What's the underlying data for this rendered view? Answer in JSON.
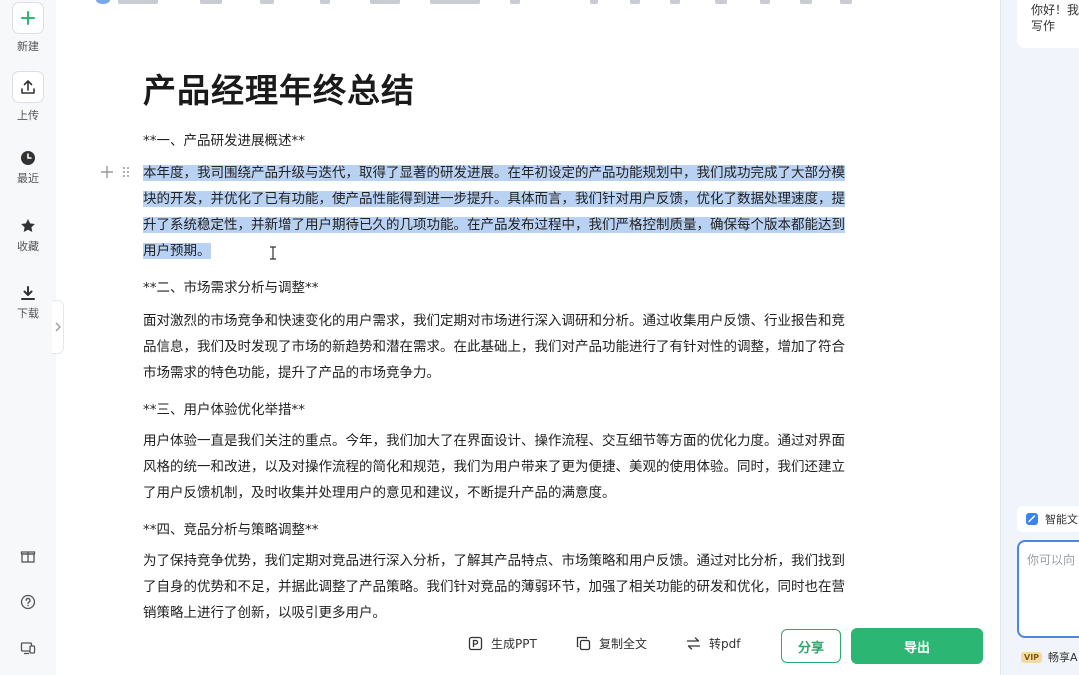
{
  "sidebar": {
    "new_label": "新建",
    "upload_label": "上传",
    "recent_label": "最近",
    "favorites_label": "收藏",
    "download_label": "下载"
  },
  "document": {
    "title": "产品经理年终总结",
    "sections": [
      {
        "heading": "**一、产品研发进展概述**",
        "lines": [
          "本年度，我司围绕产品升级与迭代，取得了显著的研发进展。在年初设定的产品功能规划中，我们成功完成了大部分模",
          "块的开发，并优化了已有功能，使产品性能得到进一步提升。具体而言，我们针对用户反馈，优化了数据处理速度，提",
          "升了系统稳定性，并新增了用户期待已久的几项功能。在产品发布过程中，我们严格控制质量，确保每个版本都能达到",
          "用户预期。"
        ]
      },
      {
        "heading": "**二、市场需求分析与调整**",
        "lines": [
          "面对激烈的市场竞争和快速变化的用户需求，我们定期对市场进行深入调研和分析。通过收集用户反馈、行业报告和竞",
          "品信息，我们及时发现了市场的新趋势和潜在需求。在此基础上，我们对产品功能进行了有针对性的调整，增加了符合",
          "市场需求的特色功能，提升了产品的市场竞争力。"
        ]
      },
      {
        "heading": "**三、用户体验优化举措**",
        "lines": [
          "用户体验一直是我们关注的重点。今年，我们加大了在界面设计、操作流程、交互细节等方面的优化力度。通过对界面",
          "风格的统一和改进，以及对操作流程的简化和规范，我们为用户带来了更为便捷、美观的使用体验。同时，我们还建立",
          "了用户反馈机制，及时收集并处理用户的意见和建议，不断提升产品的满意度。"
        ]
      },
      {
        "heading": "**四、竞品分析与策略调整**",
        "lines": [
          "为了保持竞争优势，我们定期对竞品进行深入分析，了解其产品特点、市场策略和用户反馈。通过对比分析，我们找到",
          "了自身的优势和不足，并据此调整了产品策略。我们针对竞品的薄弱环节，加强了相关功能的研发和优化，同时也在营",
          "销策略上进行了创新，以吸引更多用户。"
        ]
      }
    ]
  },
  "bottom_bar": {
    "ppt_label": "生成PPT",
    "copy_label": "复制全文",
    "pdf_label": "转pdf",
    "share_label": "分享",
    "export_label": "导出"
  },
  "right_panel": {
    "greeting_line1": "你好！我",
    "greeting_line2": "写作",
    "assistant_tab_label": "智能文",
    "input_placeholder": "你可以向",
    "vip_badge": "VIP",
    "vip_label": "畅享A"
  },
  "colors": {
    "accent_green": "#2bb673",
    "selection": "#b9d2f3",
    "focus_blue": "#4a86e8"
  }
}
